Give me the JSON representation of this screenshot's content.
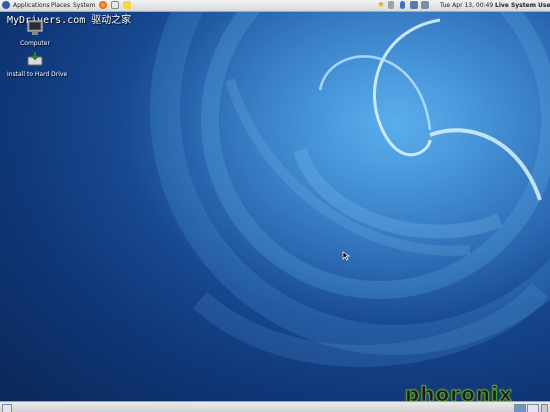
{
  "panel": {
    "menus": [
      "Applications",
      "Places",
      "System"
    ],
    "clock": "Tue Apr 13, 00:49",
    "user": "Live System User"
  },
  "watermark": "MyDrivers.com 驱动之家",
  "desktop_icons": [
    {
      "label": "Computer",
      "icon": "computer-icon"
    },
    {
      "label": "Install to Hard Drive",
      "icon": "install-drive-icon"
    }
  ],
  "branding": {
    "text": "phoronix"
  },
  "colors": {
    "panel": "#e6e6e6",
    "wallpaper_dark": "#0f3677",
    "wallpaper_light": "#4aa8ea",
    "phoronix_green": "#5c9c2b"
  }
}
